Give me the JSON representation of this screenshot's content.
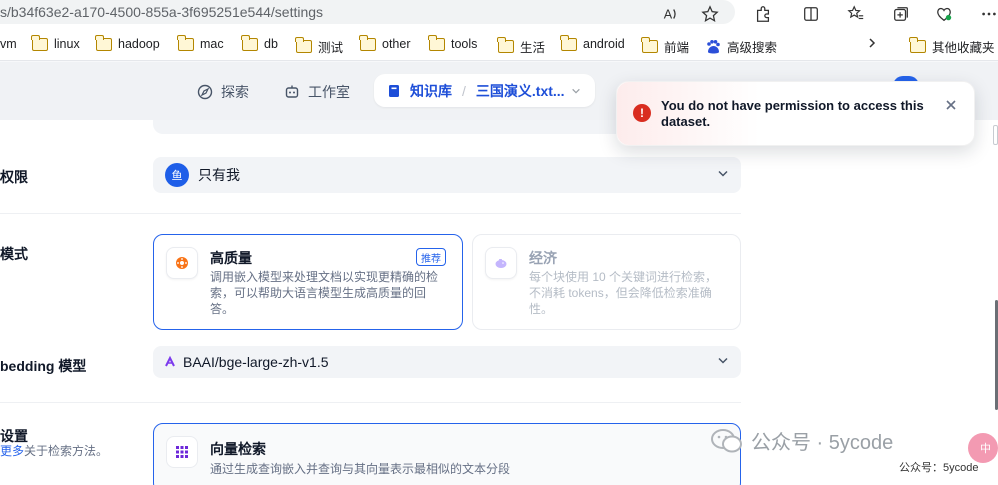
{
  "browser": {
    "url": "s/b34f63e2-a170-4500-855a-3f695251e544/settings",
    "toolbar_icons": [
      "read-aloud-icon",
      "favorite-star-icon",
      "extensions-icon",
      "split-screen-icon",
      "favorites-icon",
      "collections-icon",
      "browser-essentials-icon",
      "more-icon"
    ]
  },
  "bookmarks": {
    "items": [
      {
        "label": "vm",
        "icon": "folder-icon"
      },
      {
        "label": "linux",
        "icon": "folder-icon"
      },
      {
        "label": "hadoop",
        "icon": "folder-icon"
      },
      {
        "label": "mac",
        "icon": "folder-icon"
      },
      {
        "label": "db",
        "icon": "folder-icon"
      },
      {
        "label": "测试",
        "icon": "folder-icon"
      },
      {
        "label": "other",
        "icon": "folder-icon"
      },
      {
        "label": "tools",
        "icon": "folder-icon"
      },
      {
        "label": "生活",
        "icon": "folder-icon"
      },
      {
        "label": "android",
        "icon": "folder-icon"
      },
      {
        "label": "前端",
        "icon": "folder-icon"
      },
      {
        "label": "高级搜索",
        "icon": "baidu-paw-icon"
      }
    ],
    "more_label": "其他收藏夹"
  },
  "app_nav": {
    "explore": "探索",
    "studio": "工作室",
    "knowledge": "知识库",
    "separator": "/",
    "dataset": "三国演义.txt..."
  },
  "settings": {
    "permission": {
      "label": "权限",
      "value": "只有我",
      "avatar_text": "鱼"
    },
    "mode": {
      "label": "模式",
      "high_quality": {
        "title": "高质量",
        "badge": "推荐",
        "desc": "调用嵌入模型来处理文档以实现更精确的检索，可以帮助大语言模型生成高质量的回答。"
      },
      "economy": {
        "title": "经济",
        "desc": "每个块使用 10 个关键词进行检索，不消耗 tokens，但会降低检索准确性。"
      }
    },
    "embedding": {
      "label": "bedding 模型",
      "value": "BAAI/bge-large-zh-v1.5"
    },
    "retrieval": {
      "label": "设置",
      "learn_more_link": "更多",
      "learn_more_suffix": "关于检索方法。",
      "vector": {
        "title": "向量检索",
        "desc": "通过生成查询嵌入并查询与其向量表示最相似的文本分段"
      }
    }
  },
  "toast": {
    "message": "You do not have permission to access this dataset.",
    "type": "error"
  },
  "watermark": {
    "main": "公众号 · 5ycode",
    "sub": "公众号：5ycode",
    "bubble": "中"
  },
  "colors": {
    "accent": "#2563eb",
    "error": "#d92d20"
  }
}
